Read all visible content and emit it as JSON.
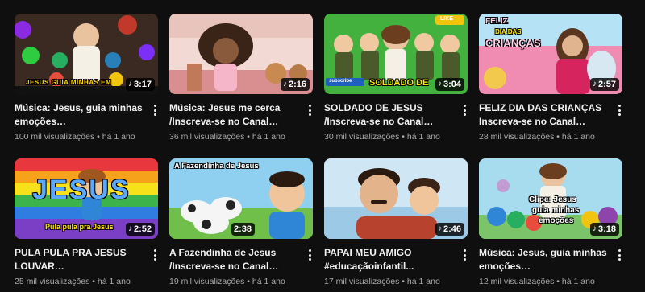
{
  "videos": [
    {
      "thumb_text": "JESUS GUIA MINHAS EM",
      "duration": "3:17",
      "title": "Música: Jesus, guia minhas emoções #educaçãoinfantil...",
      "views": "100 mil visualizações",
      "age": "há 1 ano"
    },
    {
      "thumb_text": "",
      "duration": "2:16",
      "title": "Música: Jesus me cerca /Inscreva-se no Canal #educaçãoinfantil...",
      "views": "36 mil visualizações",
      "age": "há 1 ano"
    },
    {
      "thumb_text": "SOLDADO DE",
      "thumb_badge": "LIKE",
      "thumb_sub": "subscribe",
      "duration": "3:04",
      "title": "SOLDADO DE JESUS /Inscreva-se no Canal #educaçãoinfantil...",
      "views": "30 mil visualizações",
      "age": "há 1 ano"
    },
    {
      "thumb_text_1": "FELIZ",
      "thumb_text_2": "DIA DAS",
      "thumb_text_3": "CRIANÇAS",
      "duration": "2:57",
      "title": "FELIZ DIA DAS CRIANÇAS Inscreva-se no Canal #educaçãoinfantil...",
      "views": "28 mil visualizações",
      "age": "há 1 ano"
    },
    {
      "thumb_text": "JESUS",
      "thumb_sub": "Pula pula pra Jesus",
      "duration": "2:52",
      "title": "PULA PULA PRA JESUS LOUVAR #educaçãoinfantil...",
      "views": "25 mil visualizações",
      "age": "há 1 ano"
    },
    {
      "thumb_text": "A Fazendinha de Jesus",
      "duration": "2:38",
      "title": "A Fazendinha de Jesus /Inscreva-se no Canal #educaçãoinfantil...",
      "views": "19 mil visualizações",
      "age": "há 1 ano"
    },
    {
      "thumb_text": "",
      "duration": "2:46",
      "title": "PAPAI MEU AMIGO #educaçãoinfantil...",
      "views": "17 mil visualizações",
      "age": "há 1 ano"
    },
    {
      "thumb_text_1": "Clipe: Jesus",
      "thumb_text_2": "guia minhas",
      "thumb_text_3": "emoções",
      "duration": "3:18",
      "title": "Música: Jesus, guia minhas emoções #educaçãoinfantil...",
      "views": "12 mil visualizações",
      "age": "há 1 ano"
    }
  ],
  "separator": "•",
  "icons": {
    "duration": "music-note-icon",
    "menu": "more-vert-icon"
  },
  "colors": {
    "background": "#0f0f0f",
    "title": "#f1f1f1",
    "meta": "#aaaaaa"
  }
}
